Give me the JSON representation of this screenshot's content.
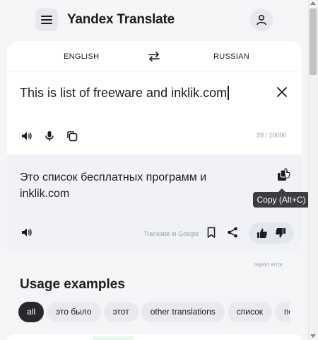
{
  "header": {
    "title": "Yandex Translate",
    "menu_icon": "hamburger-menu-icon",
    "profile_icon": "user-icon"
  },
  "languages": {
    "source": "ENGLISH",
    "target": "RUSSIAN",
    "swap_icon": "swap-arrows-icon"
  },
  "source": {
    "text": "This is list of freeware and inklik.com",
    "counter": "39 / 10000",
    "clear_icon": "close-icon",
    "tools": [
      "speaker-icon",
      "microphone-icon",
      "copy-icon"
    ]
  },
  "result": {
    "text": "Это список бесплатных программ и inklik.com",
    "translate_in": "Translate in Google",
    "tooltip": "Copy (Alt+C)",
    "tools": [
      "speaker-icon",
      "bookmark-icon",
      "share-icon",
      "thumbs-up-icon",
      "thumbs-down-icon",
      "copy-icon"
    ]
  },
  "report_error": "report error",
  "usage": {
    "title": "Usage examples",
    "chips": [
      "all",
      "это было",
      "этот",
      "other translations",
      "список",
      "по"
    ]
  },
  "colors": {
    "page_bg": "#f4f5f7",
    "card_bg": "#ffffff",
    "result_bg": "#f1f2f7",
    "active_chip": "#26282d",
    "chip_bg": "#e8eaef"
  }
}
